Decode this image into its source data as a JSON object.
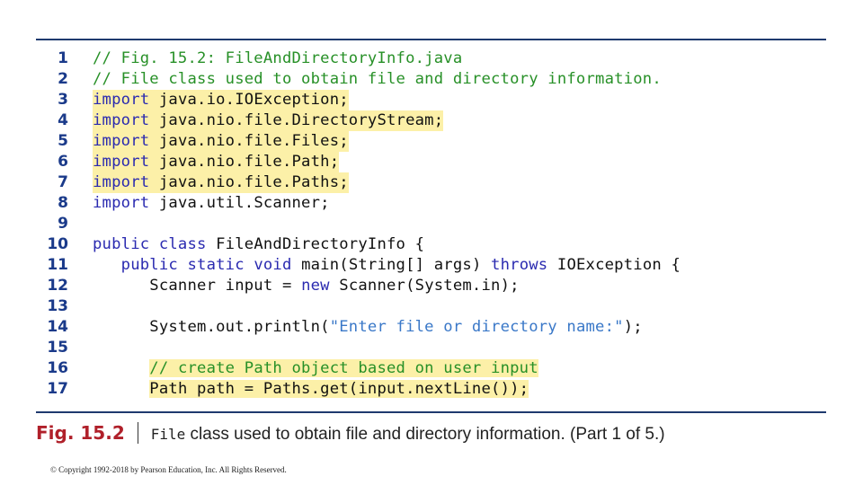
{
  "code": {
    "lines": [
      {
        "num": "1",
        "segments": [
          {
            "t": "// Fig. 15.2: FileAndDirectoryInfo.java",
            "c": "cm"
          }
        ],
        "highlight": false
      },
      {
        "num": "2",
        "segments": [
          {
            "t": "// File class used to obtain file and directory information.",
            "c": "cm"
          }
        ],
        "highlight": false
      },
      {
        "num": "3",
        "segments": [
          {
            "t": "import",
            "c": "kw"
          },
          {
            "t": " java.io.IOException;",
            "c": ""
          }
        ],
        "highlight": true
      },
      {
        "num": "4",
        "segments": [
          {
            "t": "import",
            "c": "kw"
          },
          {
            "t": " java.nio.file.DirectoryStream;",
            "c": ""
          }
        ],
        "highlight": true
      },
      {
        "num": "5",
        "segments": [
          {
            "t": "import",
            "c": "kw"
          },
          {
            "t": " java.nio.file.Files;",
            "c": ""
          }
        ],
        "highlight": true
      },
      {
        "num": "6",
        "segments": [
          {
            "t": "import",
            "c": "kw"
          },
          {
            "t": " java.nio.file.Path;",
            "c": ""
          }
        ],
        "highlight": true
      },
      {
        "num": "7",
        "segments": [
          {
            "t": "import",
            "c": "kw"
          },
          {
            "t": " java.nio.file.Paths;",
            "c": ""
          }
        ],
        "highlight": true
      },
      {
        "num": "8",
        "segments": [
          {
            "t": "import",
            "c": "kw"
          },
          {
            "t": " java.util.Scanner;",
            "c": ""
          }
        ],
        "highlight": false
      },
      {
        "num": "9",
        "segments": [],
        "highlight": false
      },
      {
        "num": "10",
        "segments": [
          {
            "t": "public class",
            "c": "kw"
          },
          {
            "t": " FileAndDirectoryInfo {",
            "c": ""
          }
        ],
        "highlight": false
      },
      {
        "num": "11",
        "segments": [
          {
            "t": "   ",
            "c": ""
          },
          {
            "t": "public static void",
            "c": "kw"
          },
          {
            "t": " main(String[] args) ",
            "c": ""
          },
          {
            "t": "throws",
            "c": "kw"
          },
          {
            "t": " IOException {",
            "c": ""
          }
        ],
        "highlight": false
      },
      {
        "num": "12",
        "segments": [
          {
            "t": "      Scanner input = ",
            "c": ""
          },
          {
            "t": "new",
            "c": "kw"
          },
          {
            "t": " Scanner(System.in);",
            "c": ""
          }
        ],
        "highlight": false
      },
      {
        "num": "13",
        "segments": [],
        "highlight": false
      },
      {
        "num": "14",
        "segments": [
          {
            "t": "      System.out.println(",
            "c": ""
          },
          {
            "t": "\"Enter file or directory name:\"",
            "c": "str"
          },
          {
            "t": ");",
            "c": ""
          }
        ],
        "highlight": false
      },
      {
        "num": "15",
        "segments": [],
        "highlight": false
      },
      {
        "num": "16",
        "segments": [
          {
            "t": "      ",
            "c": ""
          },
          {
            "t": "// create Path object based on user input",
            "c": "cm",
            "hl": true
          }
        ],
        "highlight": false
      },
      {
        "num": "17",
        "segments": [
          {
            "t": "      ",
            "c": ""
          },
          {
            "t": "Path path = Paths.get(input.nextLine());",
            "c": "",
            "hl": true
          }
        ],
        "highlight": false
      }
    ]
  },
  "caption": {
    "figure_label": "Fig. 15.2",
    "code_word": "File",
    "text": " class used to obtain file and directory information. (Part 1 of 5.)"
  },
  "copyright": "© Copyright 1992-2018 by Pearson Education, Inc. All Rights Reserved.",
  "colors": {
    "rule": "#1f3a6e",
    "highlight": "#fcf0a8",
    "keyword": "#2a2ab0",
    "comment": "#279027",
    "string": "#3a78c8",
    "line_number": "#1a3a8a",
    "figure_label": "#b0202a"
  }
}
